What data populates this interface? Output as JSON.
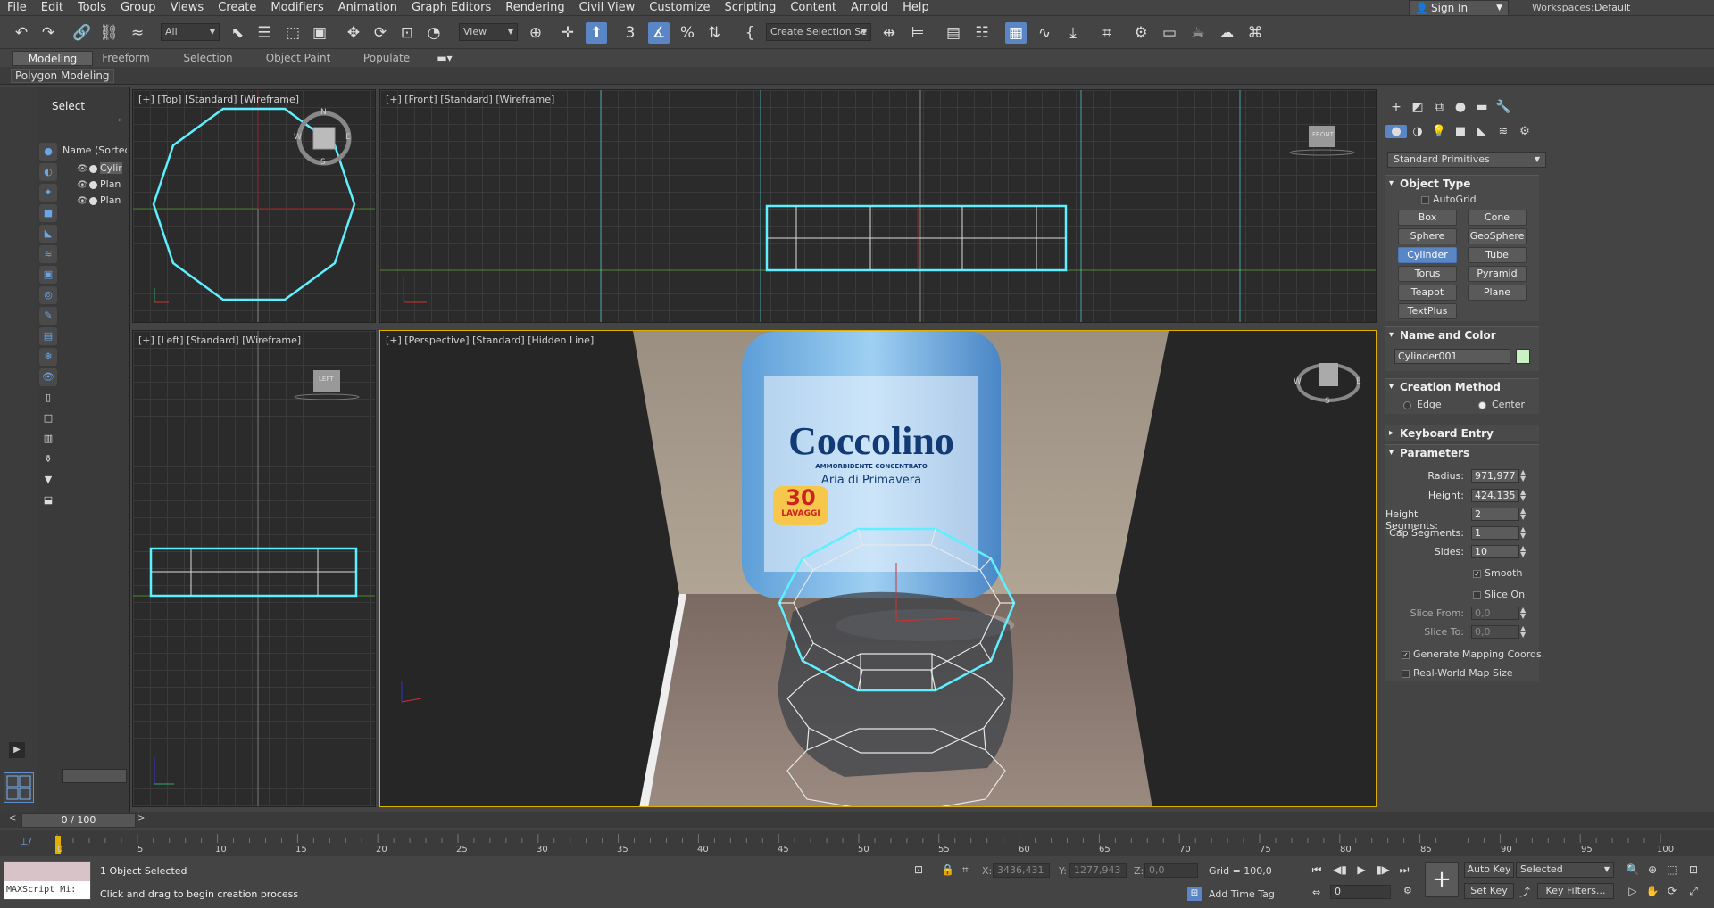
{
  "menu": [
    "File",
    "Edit",
    "Tools",
    "Group",
    "Views",
    "Create",
    "Modifiers",
    "Animation",
    "Graph Editors",
    "Rendering",
    "Civil View",
    "Customize",
    "Scripting",
    "Content",
    "Arnold",
    "Help"
  ],
  "signin": "Sign In",
  "workspaces": {
    "label": "Workspaces:",
    "value": "Default"
  },
  "toolbar": {
    "selection_filter": "All",
    "ref_coord": "View",
    "named_selection": "Create Selection Se"
  },
  "ribbon_tabs": [
    "Modeling",
    "Freeform",
    "Selection",
    "Object Paint",
    "Populate"
  ],
  "ribbon_active": "Modeling",
  "ribbon_panel": "Polygon Modeling",
  "scene_explorer": {
    "select_label": "Select",
    "header": "Name (Sorted A",
    "rows": [
      "Cylir",
      "Plan",
      "Plan"
    ]
  },
  "viewports": {
    "top": "[+] [Top] [Standard] [Wireframe]",
    "front": "[+] [Front] [Standard] [Wireframe]",
    "left": "[+] [Left] [Standard] [Wireframe]",
    "perspective": "[+] [Perspective] [Standard] [Hidden Line]",
    "viewcube_top": {
      "n": "N",
      "s": "S",
      "e": "E",
      "w": "W"
    },
    "viewcube_front": "FRONT",
    "viewcube_left": "LEFT",
    "viewcube_persp": {
      "s": "S",
      "e": "E",
      "w": "W"
    }
  },
  "photo": {
    "brand": "Coccolino",
    "line1": "AMMORBIDENTE CONCENTRATO",
    "subtitle": "Aria di Primavera",
    "badge_num": "30",
    "badge_txt": "LAVAGGI"
  },
  "command_panel": {
    "primitives_dropdown": "Standard Primitives",
    "object_type": {
      "title": "Object Type",
      "autogrid": "AutoGrid",
      "buttons": [
        "Box",
        "Cone",
        "Sphere",
        "GeoSphere",
        "Cylinder",
        "Tube",
        "Torus",
        "Pyramid",
        "Teapot",
        "Plane",
        "TextPlus"
      ],
      "active": "Cylinder"
    },
    "name_color": {
      "title": "Name and Color",
      "name": "Cylinder001",
      "color": "#c9f2c4"
    },
    "creation_method": {
      "title": "Creation Method",
      "edge": "Edge",
      "center": "Center",
      "selected": "Center"
    },
    "keyboard_entry": "Keyboard Entry",
    "parameters": {
      "title": "Parameters",
      "radius": {
        "label": "Radius:",
        "value": "971,977"
      },
      "height": {
        "label": "Height:",
        "value": "424,135"
      },
      "height_segments": {
        "label": "Height Segments:",
        "value": "2"
      },
      "cap_segments": {
        "label": "Cap Segments:",
        "value": "1"
      },
      "sides": {
        "label": "Sides:",
        "value": "10"
      },
      "smooth": "Smooth",
      "slice_on": "Slice On",
      "slice_from": {
        "label": "Slice From:",
        "value": "0,0"
      },
      "slice_to": {
        "label": "Slice To:",
        "value": "0,0"
      },
      "gen_mapping": "Generate Mapping Coords.",
      "real_world": "Real-World Map Size"
    }
  },
  "timeline": {
    "frame": "0 / 100",
    "ticks": [
      "0",
      "5",
      "10",
      "15",
      "20",
      "25",
      "30",
      "35",
      "40",
      "45",
      "50",
      "55",
      "60",
      "65",
      "70",
      "75",
      "80",
      "85",
      "90",
      "95",
      "100"
    ]
  },
  "status": {
    "maxscript": "MAXScript Mi:",
    "line1": "1 Object Selected",
    "line2": "Click and drag to begin creation process",
    "x": {
      "label": "X:",
      "value": "3436,431"
    },
    "y": {
      "label": "Y:",
      "value": "1277,943"
    },
    "z": {
      "label": "Z:",
      "value": "0,0"
    },
    "grid": "Grid = 100,0",
    "add_time_tag": "Add Time Tag",
    "auto_key": "Auto Key",
    "selected_dd": "Selected",
    "set_key": "Set Key",
    "key_filters": "Key Filters...",
    "frame_field": "0"
  },
  "colors": {
    "accent": "#5b86c5",
    "wire": "#5ef0ff",
    "persp_border": "#e0b000"
  }
}
